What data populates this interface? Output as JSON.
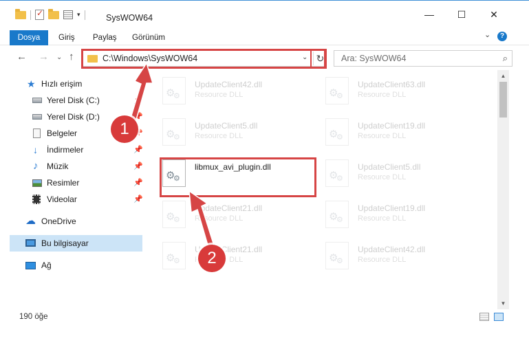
{
  "window": {
    "title": "SysWOW64",
    "minimize_glyph": "—",
    "maximize_glyph": "☐",
    "close_glyph": "✕"
  },
  "ribbon": {
    "tabs": [
      "Dosya",
      "Giriş",
      "Paylaş",
      "Görünüm"
    ],
    "expand_glyph": "⌄",
    "help_glyph": "?"
  },
  "nav": {
    "back_glyph": "←",
    "forward_glyph": "→",
    "recent_glyph": "⌄",
    "up_glyph": "↑",
    "address": "C:\\Windows\\SysWOW64",
    "address_dropdown_glyph": "⌄",
    "refresh_glyph": "↻",
    "search_placeholder": "Ara: SysWOW64",
    "search_glyph": "⌕"
  },
  "sidebar": {
    "items": [
      {
        "label": "Hızlı erişim",
        "icon": "star-icon",
        "pinned": false
      },
      {
        "label": "Yerel Disk (C:)",
        "icon": "drive-icon",
        "pinned": true
      },
      {
        "label": "Yerel Disk (D:)",
        "icon": "drive-icon",
        "pinned": true
      },
      {
        "label": "Belgeler",
        "icon": "documents-icon",
        "pinned": true
      },
      {
        "label": "İndirmeler",
        "icon": "download-icon",
        "pinned": true
      },
      {
        "label": "Müzik",
        "icon": "music-icon",
        "pinned": true
      },
      {
        "label": "Resimler",
        "icon": "pictures-icon",
        "pinned": true
      },
      {
        "label": "Videolar",
        "icon": "videos-icon",
        "pinned": true
      },
      {
        "label": "OneDrive",
        "icon": "cloud-icon",
        "pinned": false
      },
      {
        "label": "Bu bilgisayar",
        "icon": "computer-icon",
        "pinned": false,
        "selected": true
      },
      {
        "label": "Ağ",
        "icon": "network-icon",
        "pinned": false
      }
    ]
  },
  "files": {
    "left": [
      {
        "name": "UpdateClient42.dll",
        "type": "Resource DLL",
        "faded": true
      },
      {
        "name": "UpdateClient5.dll",
        "type": "Resource DLL",
        "faded": true
      },
      {
        "name": "libmux_avi_plugin.dll",
        "type": "",
        "faded": false
      },
      {
        "name": "UpdateClient21.dll",
        "type": "Resource DLL",
        "faded": true
      },
      {
        "name": "UpdateClient21.dll",
        "type": "Resource DLL",
        "faded": true
      }
    ],
    "right": [
      {
        "name": "UpdateClient63.dll",
        "type": "Resource DLL",
        "faded": true
      },
      {
        "name": "UpdateClient19.dll",
        "type": "Resource DLL",
        "faded": true
      },
      {
        "name": "UpdateClient5.dll",
        "type": "Resource DLL",
        "faded": true
      },
      {
        "name": "UpdateClient19.dll",
        "type": "Resource DLL",
        "faded": true
      },
      {
        "name": "UpdateClient42.dll",
        "type": "Resource DLL",
        "faded": true
      }
    ]
  },
  "status": {
    "item_count": "190 öğe"
  },
  "annotations": {
    "step1": "1",
    "step2": "2",
    "color": "#d64545"
  },
  "scrollbar": {
    "up_glyph": "▲",
    "down_glyph": "▼"
  }
}
